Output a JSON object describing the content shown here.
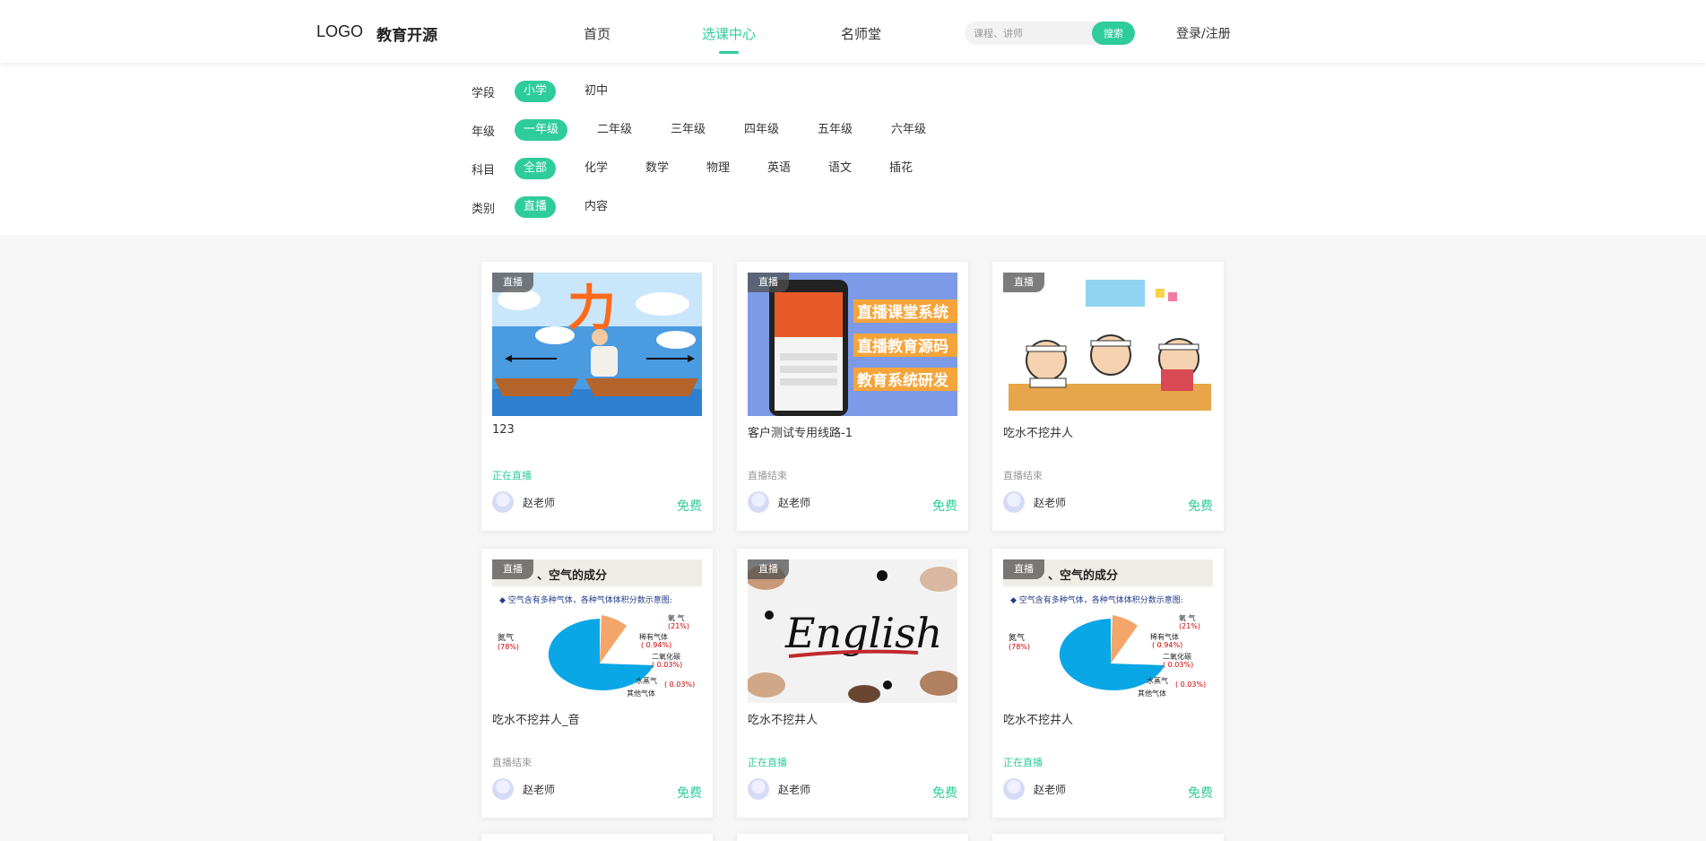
{
  "header": {
    "logo": "LOGO",
    "brand": "教育开源",
    "nav": [
      "首页",
      "选课中心",
      "名师堂"
    ],
    "search_placeholder": "课程、讲师",
    "search_button": "搜索",
    "login": "登录/注册"
  },
  "filters": {
    "stage": {
      "label": "学段",
      "options": [
        "小学",
        "初中"
      ],
      "selected": "小学"
    },
    "grade": {
      "label": "年级",
      "options": [
        "一年级",
        "二年级",
        "三年级",
        "四年级",
        "五年级",
        "六年级"
      ],
      "selected": "一年级"
    },
    "subject": {
      "label": "科目",
      "options": [
        "全部",
        "化学",
        "数学",
        "物理",
        "英语",
        "语文",
        "插花"
      ],
      "selected": "全部"
    },
    "type": {
      "label": "类别",
      "options": [
        "直播",
        "内容"
      ],
      "selected": "直播"
    }
  },
  "courses": [
    {
      "tag": "直播",
      "title": "123",
      "status": "正在直播",
      "teacher": "赵老师",
      "price": "免费",
      "thumb": "boats-force-icon"
    },
    {
      "tag": "直播",
      "title": "客户测试专用线路-1",
      "status": "直播结束",
      "teacher": "赵老师",
      "price": "免费",
      "thumb": "phone-promo-icon",
      "thumb_text": [
        "直播课堂系统",
        "直播教育源码",
        "教育系统研发"
      ]
    },
    {
      "tag": "直播",
      "title": "吃水不挖井人",
      "status": "直播结束",
      "teacher": "赵老师",
      "price": "免费",
      "thumb": "kids-studying-icon"
    },
    {
      "tag": "直播",
      "title": "吃水不挖井人_音",
      "status": "直播结束",
      "teacher": "赵老师",
      "price": "免费",
      "thumb": "air-pie-chart-icon",
      "thumb_text": {
        "heading": "、空气的成分",
        "subtitle": "◆ 空气含有多种气体，各种气体体积分数示意图:",
        "labels": [
          "氮气",
          "(78%)",
          "氧 气",
          "(21%)",
          "稀有气体",
          "( 0.94%)",
          "二氧化碳",
          "( 0.03%)",
          "水蒸气",
          "( 0.03%)",
          "其他气体"
        ]
      }
    },
    {
      "tag": "直播",
      "title": "吃水不挖井人",
      "status": "正在直播",
      "teacher": "赵老师",
      "price": "免费",
      "thumb": "english-lettering-icon",
      "thumb_text": "English"
    },
    {
      "tag": "直播",
      "title": "吃水不挖井人",
      "status": "正在直播",
      "teacher": "赵老师",
      "price": "免费",
      "thumb": "air-pie-chart-icon",
      "thumb_text": {
        "heading": "、空气的成分",
        "subtitle": "◆ 空气含有多种气体，各种气体体积分数示意图:",
        "labels": [
          "氮气",
          "(78%)",
          "氧 气",
          "(21%)",
          "稀有气体",
          "( 0.94%)",
          "二氧化碳",
          "( 0.03%)",
          "水蒸气",
          "( 0.03%)",
          "其他气体"
        ]
      }
    }
  ],
  "colors": {
    "accent": "#2fcc9b",
    "background": "#f6f6f6"
  }
}
